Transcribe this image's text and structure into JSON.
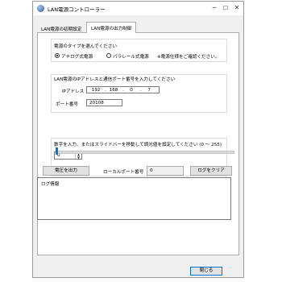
{
  "window": {
    "title": "LAN電源コントローラー",
    "controls": {
      "minimize": "─",
      "maximize": "☐",
      "close": "✕"
    }
  },
  "tabs": [
    {
      "label": "LAN電源の初期設定",
      "active": false
    },
    {
      "label": "LAN電源の出力制御",
      "active": true
    }
  ],
  "power_type": {
    "prompt": "電源のタイプを選んでください",
    "options": [
      {
        "label": "アナログ式電源",
        "selected": true
      },
      {
        "label": "パラレール式電源",
        "selected": false
      }
    ],
    "note": "※電源仕様をご確認ください。"
  },
  "network": {
    "prompt": "LAN電源のIPアドレスと通信ポート番号を入力してください",
    "ip_label": "IPアドレス",
    "ip_segments": [
      "192",
      "168",
      "0",
      "7"
    ],
    "port_label": "ポート番号",
    "port_value": "20108"
  },
  "level": {
    "prompt": "数字を入力、またはスライドバーを移動して調光値を設定してください (0 ～ 255)",
    "spinner_value": "0",
    "range": [
      0,
      255
    ],
    "slider_value": 0
  },
  "actions": {
    "output_button": "電圧を出力",
    "local_port_label": "ローカルポート番号",
    "local_port_value": "0",
    "clear_log_button": "ログをクリア"
  },
  "log": {
    "text": "ログ情報"
  },
  "footer": {
    "close_button": "閉じる"
  },
  "colors": {
    "accent": "#0078d7",
    "window_bg": "#f0f0f0",
    "panel_bg": "#ffffff"
  }
}
